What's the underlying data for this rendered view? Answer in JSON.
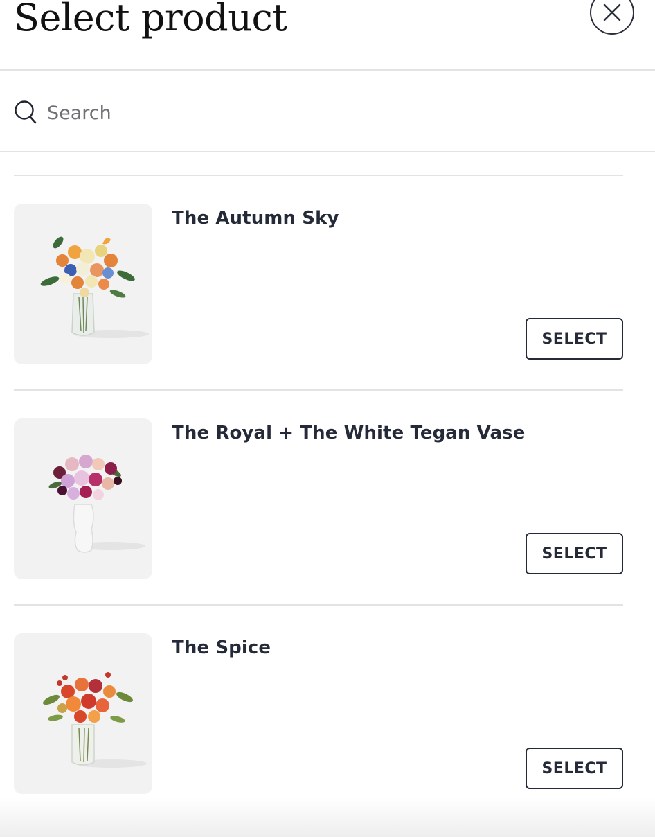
{
  "header": {
    "title": "Select product",
    "close_icon": "close-icon"
  },
  "search": {
    "placeholder": "Search",
    "value": "",
    "icon": "search-icon"
  },
  "products": [
    {
      "name": "The Autumn Sky",
      "select_label": "SELECT",
      "image": "autumn-bouquet-in-glass-vase"
    },
    {
      "name": "The Royal + The White Tegan Vase",
      "select_label": "SELECT",
      "image": "pink-purple-bouquet-in-white-vase"
    },
    {
      "name": "The Spice",
      "select_label": "SELECT",
      "image": "orange-red-bouquet-in-glass-vase"
    }
  ],
  "colors": {
    "text": "#242a38",
    "divider": "#e3e3e3",
    "thumb_bg": "#f2f2f2"
  }
}
